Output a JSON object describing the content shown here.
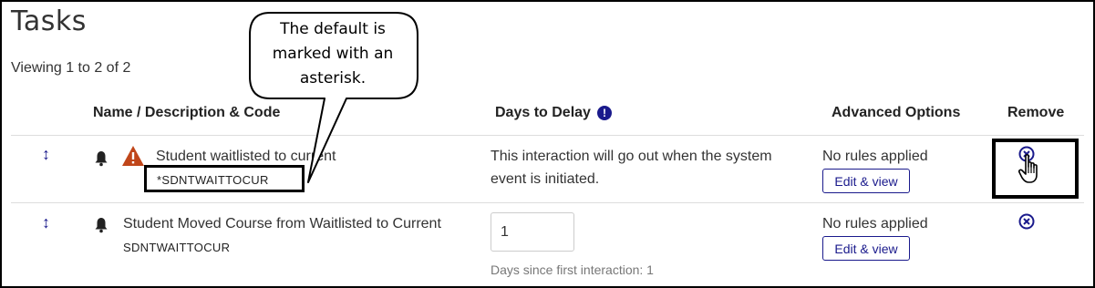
{
  "page": {
    "title": "Tasks",
    "viewing": "Viewing 1 to 2 of 2"
  },
  "table": {
    "headers": {
      "name": "Name / Description & Code",
      "days": "Days to Delay",
      "advanced": "Advanced Options",
      "remove": "Remove"
    },
    "rows": [
      {
        "name": "Student waitlisted to current",
        "code": "*SDNTWAITTOCUR",
        "days_text_line1": "This interaction will go out when the system",
        "days_text_line2": "event is initiated.",
        "rules": "No rules applied",
        "edit_label": "Edit & view",
        "warning": true
      },
      {
        "name": "Student Moved Course from Waitlisted to Current",
        "code": "SDNTWAITTOCUR",
        "days_value": "1",
        "days_help": "Days since first interaction: 1",
        "rules": "No rules applied",
        "edit_label": "Edit & view",
        "warning": false
      }
    ]
  },
  "callout": {
    "line1": "The default is",
    "line2": "marked with an",
    "line3": "asterisk."
  },
  "icons": {
    "drag": "drag-handle-icon",
    "bell": "bell-icon",
    "warning": "warning-icon",
    "info": "info-icon",
    "remove": "remove-circle-x-icon",
    "cursor": "hand-pointer-icon"
  },
  "colors": {
    "accent": "#1a1a8c",
    "warning": "#c0461a"
  }
}
